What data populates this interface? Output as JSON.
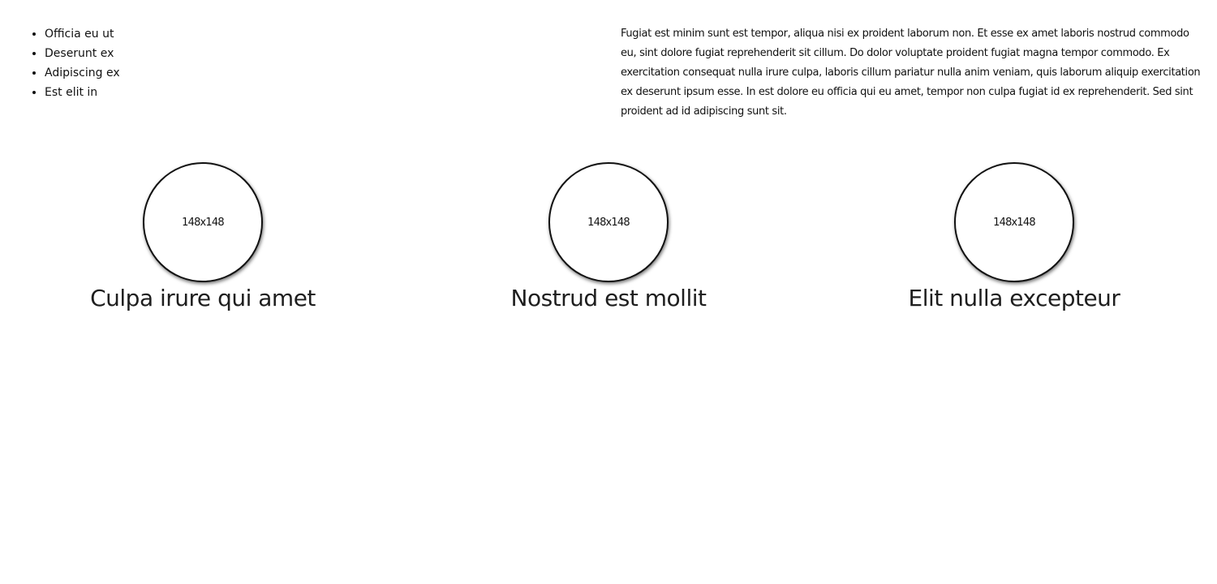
{
  "bullets": [
    "Officia eu ut",
    "Deserunt ex",
    "Adipiscing ex",
    "Est elit in"
  ],
  "paragraph": "Fugiat est minim sunt est tempor, aliqua nisi ex proident laborum non. Et esse ex amet laboris nostrud commodo eu, sint dolore fugiat reprehenderit sit cillum. Do dolor voluptate proident fugiat magna tempor commodo. Ex exercitation consequat nulla irure culpa, laboris cillum pariatur nulla anim veniam, quis laborum aliquip exercitation ex deserunt ipsum esse. In est dolore eu officia qui eu amet, tempor non culpa fugiat id ex reprehenderit. Sed sint proident ad id adipiscing sunt sit.",
  "cards": [
    {
      "image_label": "148x148",
      "title": "Culpa irure qui amet"
    },
    {
      "image_label": "148x148",
      "title": "Nostrud est mollit"
    },
    {
      "image_label": "148x148",
      "title": "Elit nulla excepteur"
    }
  ]
}
